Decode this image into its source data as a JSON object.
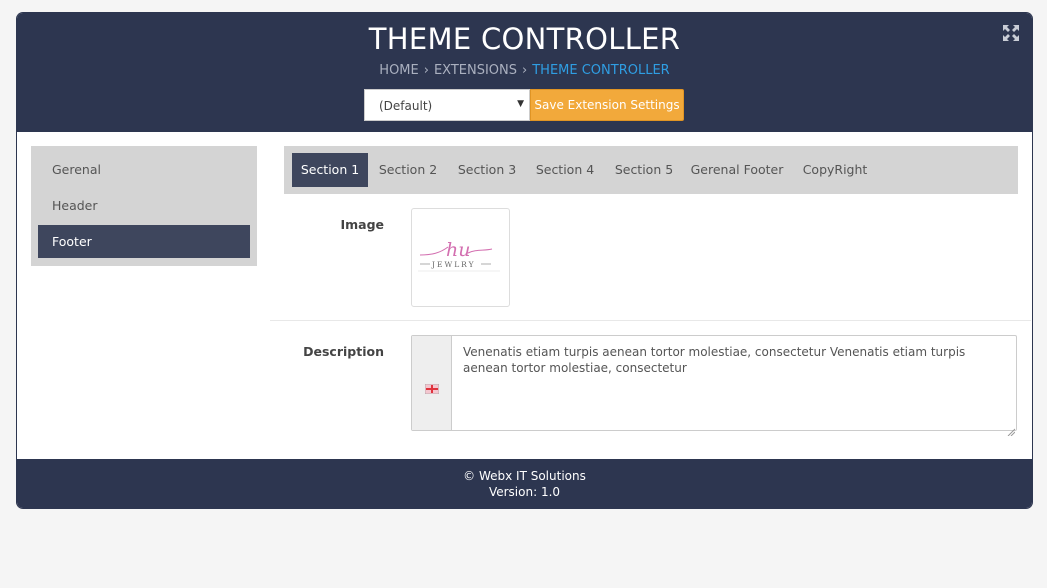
{
  "header": {
    "title": "THEME CONTROLLER",
    "breadcrumb": [
      {
        "label": "HOME"
      },
      {
        "label": "EXTENSIONS"
      },
      {
        "label": "THEME CONTROLLER"
      }
    ],
    "breadcrumb_separator": "›",
    "expand_icon": "expand-arrows-icon",
    "store_select": {
      "value": "(Default)"
    },
    "save_label": "Save Extension Settings"
  },
  "sidebar": {
    "items": [
      {
        "label": "Gerenal"
      },
      {
        "label": "Header"
      },
      {
        "label": "Footer",
        "active": true
      }
    ]
  },
  "tabs": [
    {
      "label": "Section 1",
      "active": true
    },
    {
      "label": "Section 2"
    },
    {
      "label": "Section 3"
    },
    {
      "label": "Section 4"
    },
    {
      "label": "Section 5"
    },
    {
      "label": "Gerenal Footer"
    },
    {
      "label": "CopyRight"
    }
  ],
  "form": {
    "image_label": "Image",
    "logo": {
      "script_text": "hu",
      "sub_text": "JEWLRY"
    },
    "description_label": "Description",
    "description_value": "Venenatis etiam turpis aenean tortor molestiae, consectetur Venenatis etiam turpis aenean tortor molestiae, consectetur",
    "language_flag_icon": "uk-flag-icon"
  },
  "footer": {
    "copyright": "© Webx IT Solutions",
    "version": "Version: 1.0"
  },
  "colors": {
    "header_bg": "#2d3650",
    "accent_button": "#f2a93b",
    "active_item": "#3e465d",
    "breadcrumb_active": "#2f9ee3"
  }
}
